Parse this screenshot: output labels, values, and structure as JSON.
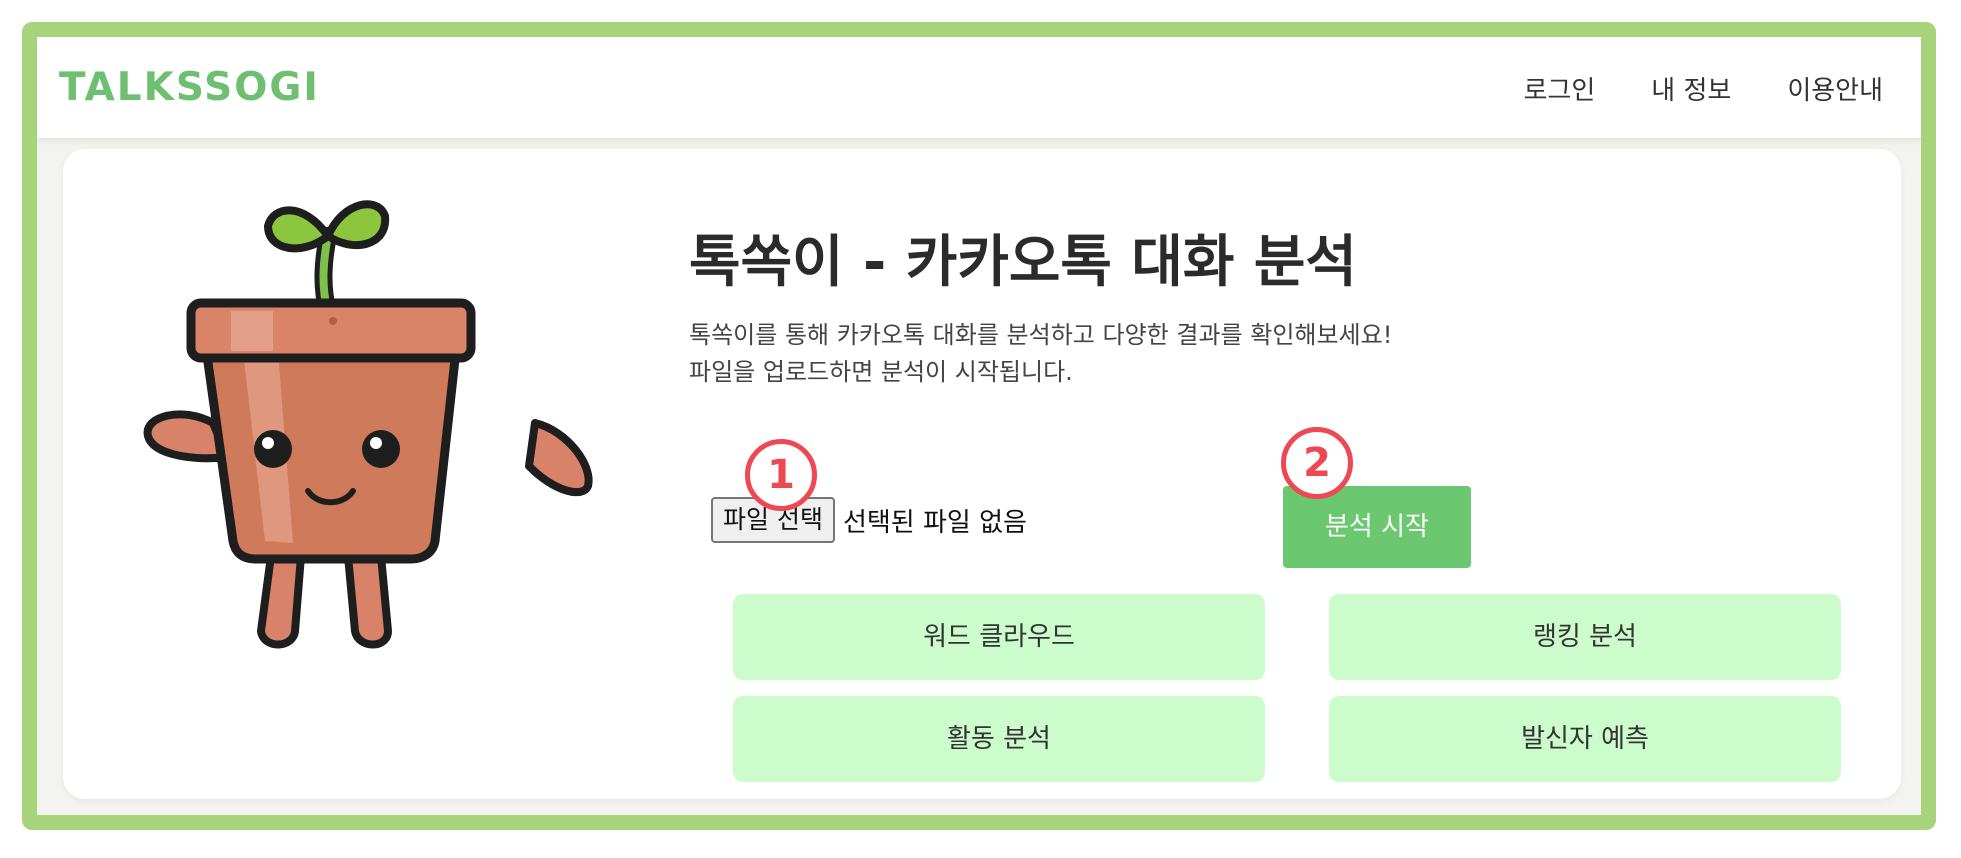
{
  "header": {
    "brand": "TALKSSOGI",
    "nav": [
      {
        "label": "로그인"
      },
      {
        "label": "내 정보"
      },
      {
        "label": "이용안내"
      }
    ]
  },
  "hero": {
    "title": "톡쏙이 - 카카오톡 대화 분석",
    "description_line1": "톡쏙이를 통해 카카오톡 대화를 분석하고 다양한 결과를 확인해보세요!",
    "description_line2": "파일을 업로드하면 분석이 시작됩니다."
  },
  "upload": {
    "file_button_label": "파일 선택",
    "file_status": "선택된 파일 없음",
    "start_button_label": "분석 시작"
  },
  "markers": [
    "1",
    "2"
  ],
  "features": [
    {
      "label": "워드 클라우드"
    },
    {
      "label": "랭킹 분석"
    },
    {
      "label": "활동 분석"
    },
    {
      "label": "발신자 예측"
    }
  ],
  "colors": {
    "frame": "#a7d47a",
    "brand": "#6fbf73",
    "start_button": "#6cc870",
    "feature_button": "#ccfccc",
    "marker": "#ee4852"
  },
  "icons": {
    "mascot": "flowerpot-sprout-mascot"
  }
}
